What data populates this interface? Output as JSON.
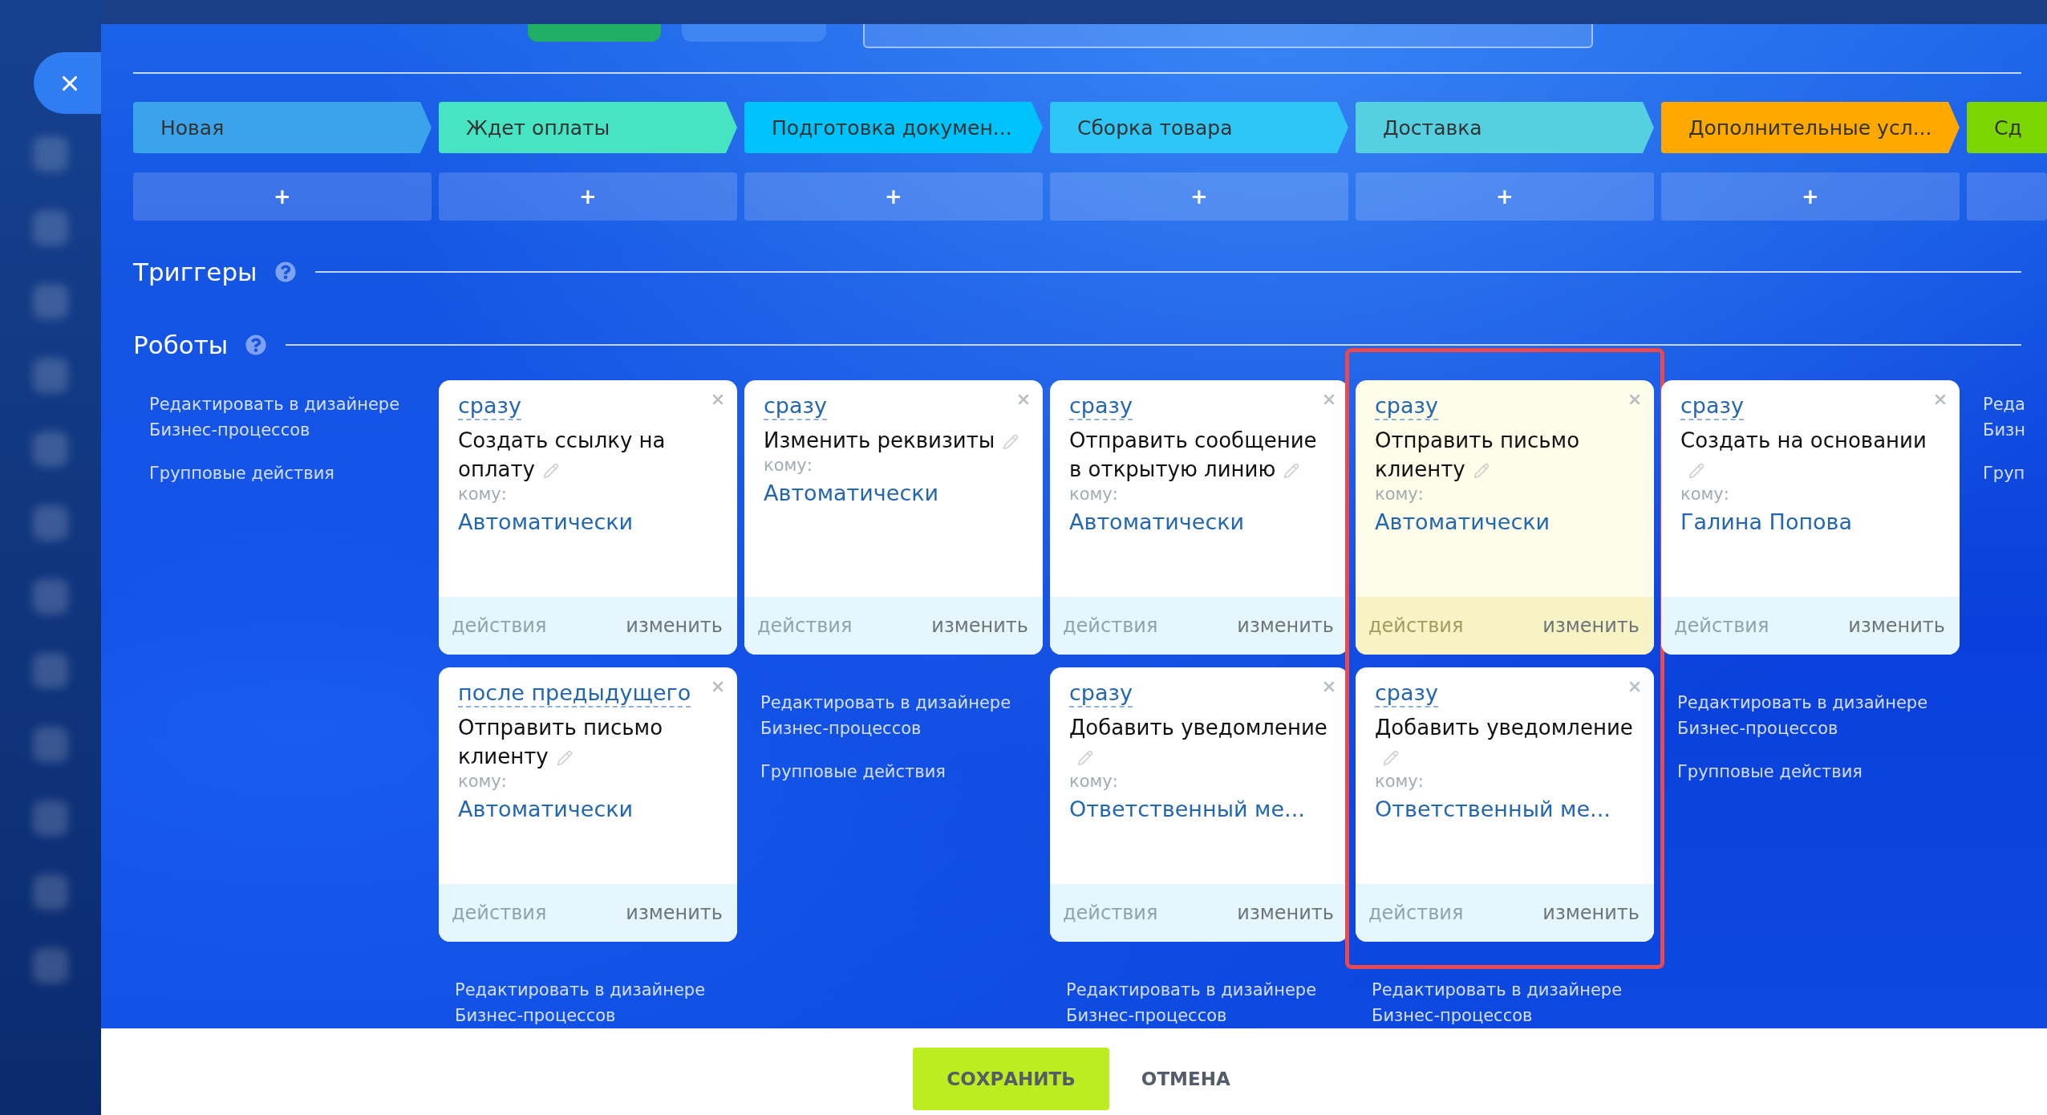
{
  "columns": [
    {
      "stage": {
        "label": "Новая",
        "color": "#3ba3ec"
      },
      "add": "+",
      "items": [
        {
          "kind": "links",
          "links": [
            {
              "lines": [
                "Редактировать в дизайнере",
                "Бизнес-процессов"
              ]
            },
            {
              "lines": [
                "Групповые действия"
              ]
            }
          ]
        }
      ]
    },
    {
      "stage": {
        "label": "Ждет оплаты",
        "color": "#47e4c4"
      },
      "add": "+",
      "items": [
        {
          "kind": "robot",
          "timing": "сразу",
          "title": "Создать ссылку на оплату",
          "recipient_label": "кому:",
          "recipient": "Автоматически",
          "actions": "действия",
          "edit": "изменить",
          "highlighted": false
        },
        {
          "kind": "robot",
          "timing": "после предыдущего",
          "title": "Отправить письмо клиенту",
          "recipient_label": "кому:",
          "recipient": "Автоматически",
          "actions": "действия",
          "edit": "изменить",
          "highlighted": false
        },
        {
          "kind": "links",
          "links": [
            {
              "lines": [
                "Редактировать в дизайнере",
                "Бизнес-процессов"
              ]
            }
          ]
        }
      ]
    },
    {
      "stage": {
        "label": "Подготовка докумен...",
        "color": "#00c2fb"
      },
      "add": "+",
      "items": [
        {
          "kind": "robot",
          "timing": "сразу",
          "title": "Изменить реквизиты",
          "recipient_label": "кому:",
          "recipient": "Автоматически",
          "actions": "действия",
          "edit": "изменить",
          "highlighted": false
        },
        {
          "kind": "links",
          "links": [
            {
              "lines": [
                "Редактировать в дизайнере",
                "Бизнес-процессов"
              ]
            },
            {
              "lines": [
                "Групповые действия"
              ]
            }
          ]
        }
      ]
    },
    {
      "stage": {
        "label": "Сборка товара",
        "color": "#2fc5f6"
      },
      "add": "+",
      "items": [
        {
          "kind": "robot",
          "timing": "сразу",
          "title": "Отправить сообщение в открытую линию",
          "recipient_label": "кому:",
          "recipient": "Автоматически",
          "actions": "действия",
          "edit": "изменить",
          "highlighted": false
        },
        {
          "kind": "robot",
          "timing": "сразу",
          "title": "Добавить уведомление",
          "recipient_label": "кому:",
          "recipient": "Ответственный ме...",
          "actions": "действия",
          "edit": "изменить",
          "highlighted": false
        },
        {
          "kind": "links",
          "links": [
            {
              "lines": [
                "Редактировать в дизайнере",
                "Бизнес-процессов"
              ]
            }
          ]
        }
      ]
    },
    {
      "stage": {
        "label": "Доставка",
        "color": "#55d0e0"
      },
      "add": "+",
      "framed": true,
      "items": [
        {
          "kind": "robot",
          "timing": "сразу",
          "title": "Отправить письмо клиенту",
          "recipient_label": "кому:",
          "recipient": "Автоматически",
          "actions": "действия",
          "edit": "изменить",
          "highlighted": true
        },
        {
          "kind": "robot",
          "timing": "сразу",
          "title": "Добавить уведомление",
          "recipient_label": "кому:",
          "recipient": "Ответственный ме...",
          "actions": "действия",
          "edit": "изменить",
          "highlighted": false
        },
        {
          "kind": "links",
          "links": [
            {
              "lines": [
                "Редактировать в дизайнере",
                "Бизнес-процессов"
              ]
            }
          ]
        }
      ]
    },
    {
      "stage": {
        "label": "Дополнительные усл...",
        "color": "#ffa900"
      },
      "add": "+",
      "items": [
        {
          "kind": "robot",
          "timing": "сразу",
          "title": "Создать на основании",
          "recipient_label": "кому:",
          "recipient": "Галина Попова",
          "actions": "действия",
          "edit": "изменить",
          "highlighted": false
        },
        {
          "kind": "links",
          "links": [
            {
              "lines": [
                "Редактировать в дизайнере",
                "Бизнес-процессов"
              ]
            },
            {
              "lines": [
                "Групповые действия"
              ]
            }
          ]
        }
      ]
    },
    {
      "stage": {
        "label": "Сд",
        "color": "#7bd500"
      },
      "items": [
        {
          "kind": "links",
          "links": [
            {
              "lines": [
                "Реда",
                "Бизн"
              ]
            },
            {
              "lines": [
                "Груп"
              ]
            }
          ]
        }
      ]
    }
  ],
  "sections": [
    {
      "title": "Триггеры"
    },
    {
      "title": "Роботы"
    }
  ],
  "footer": {
    "save": "СОХРАНИТЬ",
    "cancel": "ОТМЕНА"
  }
}
